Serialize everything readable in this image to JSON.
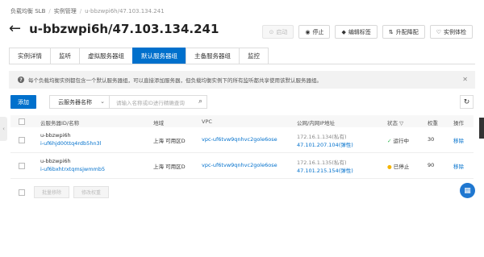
{
  "breadcrumb": {
    "items": [
      "负载均衡 SLB",
      "实例管理",
      "u-bbzwpi6h/47.103.134.241"
    ]
  },
  "page": {
    "title": "u-bbzwpi6h/47.103.134.241"
  },
  "actions": {
    "start": "启动",
    "stop": "停止",
    "edit_tags": "编辑标签",
    "upgrade": "升配降配",
    "inspect": "实例体检"
  },
  "tabs": [
    "实例详情",
    "监听",
    "虚拟服务器组",
    "默认服务器组",
    "主备服务器组",
    "监控"
  ],
  "active_tab": "默认服务器组",
  "notice": {
    "text": "每个负载均衡实例都包含一个默认服务器组，可以直接添加服务器，但负载均衡实例下的所有监听都共享使用该默认服务器组。"
  },
  "toolbar": {
    "add": "添加",
    "filter": "云服务器名称",
    "search_placeholder": "请输入名称或ID进行精确查询"
  },
  "table": {
    "columns": {
      "name": "云服务器ID/名称",
      "zone": "地域",
      "vpc": "VPC",
      "ip": "公网/内网IP地址",
      "status": "状态",
      "weight": "权重",
      "ops": "操作"
    },
    "rows": [
      {
        "name": "u-bbzwpi6h",
        "id": "i-uf6hjd00ttq4rdb5hn3l",
        "zone": "上海 可用区D",
        "vpc": "vpc-uf6tvw9qnhvc2gole6ose",
        "private_ip": "172.16.1.134(私有)",
        "public_ip": "47.101.207.104(弹性)",
        "status": "运行中",
        "weight": "30",
        "op": "移除"
      },
      {
        "name": "u-bbzwpi6h",
        "id": "i-uf6bxhtrxtqmsjwmmb5",
        "zone": "上海 可用区D",
        "vpc": "vpc-uf6tvw9qnhvc2gole6ose",
        "private_ip": "172.16.1.135(私有)",
        "public_ip": "47.101.215.154(弹性)",
        "status": "已停止",
        "weight": "90",
        "op": "移除"
      }
    ]
  },
  "bulk": {
    "remove": "批量移除",
    "edit_weight": "修改权重"
  },
  "colors": {
    "accent": "#0070cc",
    "running": "#2db84d",
    "stopped": "#f5b400"
  }
}
